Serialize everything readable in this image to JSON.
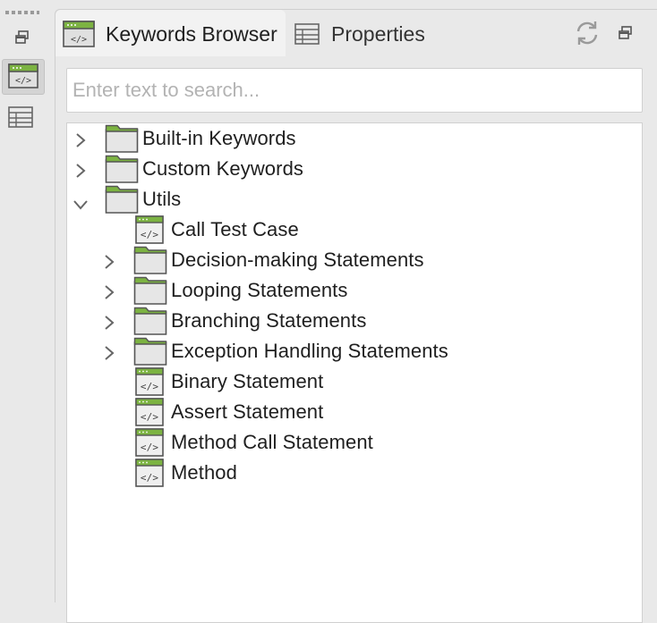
{
  "left_toolbar": {
    "items": [
      "restore-icon",
      "keywords-browser-icon",
      "properties-icon"
    ]
  },
  "tabs": [
    {
      "label": "Keywords Browser",
      "icon": "keywords-browser-icon",
      "active": true
    },
    {
      "label": "Properties",
      "icon": "properties-table-icon",
      "active": false
    }
  ],
  "header_actions": [
    "refresh-icon",
    "restore-icon"
  ],
  "search": {
    "placeholder": "Enter text to search...",
    "value": ""
  },
  "tree": {
    "items": [
      {
        "label": "Built-in Keywords",
        "type": "folder",
        "depth": 0,
        "expanded": false
      },
      {
        "label": "Custom Keywords",
        "type": "folder",
        "depth": 0,
        "expanded": false
      },
      {
        "label": "Utils",
        "type": "folder",
        "depth": 0,
        "expanded": true
      },
      {
        "label": "Call Test Case",
        "type": "keyword",
        "depth": 1
      },
      {
        "label": "Decision-making Statements",
        "type": "folder",
        "depth": 1,
        "expanded": false
      },
      {
        "label": "Looping Statements",
        "type": "folder",
        "depth": 1,
        "expanded": false
      },
      {
        "label": "Branching Statements",
        "type": "folder",
        "depth": 1,
        "expanded": false
      },
      {
        "label": "Exception Handling Statements",
        "type": "folder",
        "depth": 1,
        "expanded": false
      },
      {
        "label": "Binary Statement",
        "type": "keyword",
        "depth": 1
      },
      {
        "label": "Assert Statement",
        "type": "keyword",
        "depth": 1
      },
      {
        "label": "Method Call Statement",
        "type": "keyword",
        "depth": 1
      },
      {
        "label": "Method",
        "type": "keyword",
        "depth": 1
      }
    ]
  },
  "colors": {
    "accent_green": "#7cb342",
    "icon_stroke": "#555555"
  }
}
